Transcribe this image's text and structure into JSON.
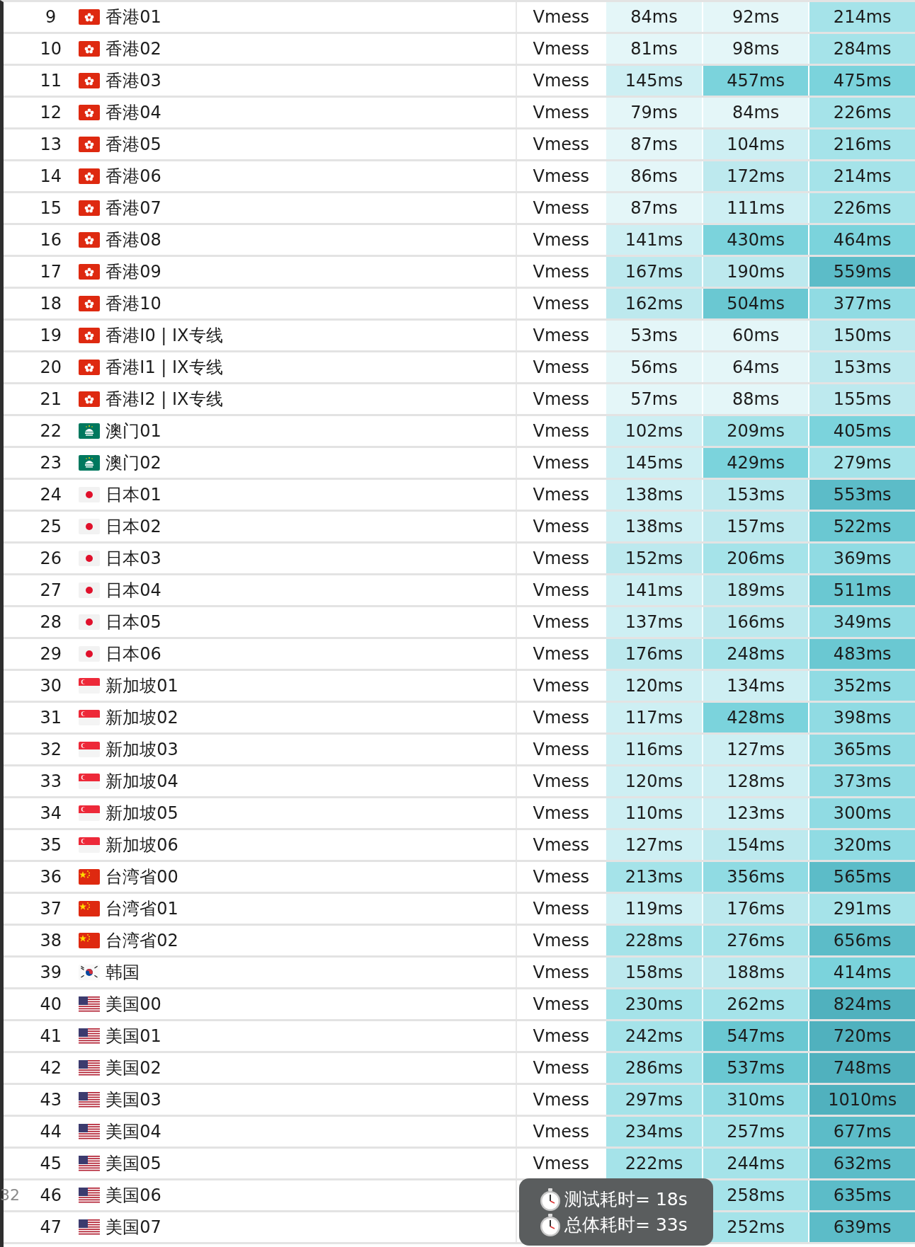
{
  "rows": [
    {
      "index": "9",
      "kind": "hk",
      "name": "香港01",
      "protocol": "Vmess",
      "latencies": [
        {
          "text": "84ms",
          "color": "#e4f6f8"
        },
        {
          "text": "92ms",
          "color": "#e4f6f8"
        },
        {
          "text": "214ms",
          "color": "#a5e3e9"
        }
      ]
    },
    {
      "index": "10",
      "kind": "hk",
      "name": "香港02",
      "protocol": "Vmess",
      "latencies": [
        {
          "text": "81ms",
          "color": "#e4f6f8"
        },
        {
          "text": "98ms",
          "color": "#e4f6f8"
        },
        {
          "text": "284ms",
          "color": "#a5e3e9"
        }
      ]
    },
    {
      "index": "11",
      "kind": "hk",
      "name": "香港03",
      "protocol": "Vmess",
      "latencies": [
        {
          "text": "145ms",
          "color": "#ceeff3"
        },
        {
          "text": "457ms",
          "color": "#7bd3dc"
        },
        {
          "text": "475ms",
          "color": "#7bd3dc"
        }
      ]
    },
    {
      "index": "12",
      "kind": "hk",
      "name": "香港04",
      "protocol": "Vmess",
      "latencies": [
        {
          "text": "79ms",
          "color": "#e4f6f8"
        },
        {
          "text": "84ms",
          "color": "#e4f6f8"
        },
        {
          "text": "226ms",
          "color": "#a5e3e9"
        }
      ]
    },
    {
      "index": "13",
      "kind": "hk",
      "name": "香港05",
      "protocol": "Vmess",
      "latencies": [
        {
          "text": "87ms",
          "color": "#e4f6f8"
        },
        {
          "text": "104ms",
          "color": "#ceeff3"
        },
        {
          "text": "216ms",
          "color": "#a5e3e9"
        }
      ]
    },
    {
      "index": "14",
      "kind": "hk",
      "name": "香港06",
      "protocol": "Vmess",
      "latencies": [
        {
          "text": "86ms",
          "color": "#e4f6f8"
        },
        {
          "text": "172ms",
          "color": "#bde9ee"
        },
        {
          "text": "214ms",
          "color": "#a5e3e9"
        }
      ]
    },
    {
      "index": "15",
      "kind": "hk",
      "name": "香港07",
      "protocol": "Vmess",
      "latencies": [
        {
          "text": "87ms",
          "color": "#e4f6f8"
        },
        {
          "text": "111ms",
          "color": "#ceeff3"
        },
        {
          "text": "226ms",
          "color": "#a5e3e9"
        }
      ]
    },
    {
      "index": "16",
      "kind": "hk",
      "name": "香港08",
      "protocol": "Vmess",
      "latencies": [
        {
          "text": "141ms",
          "color": "#ceeff3"
        },
        {
          "text": "430ms",
          "color": "#7bd3dc"
        },
        {
          "text": "464ms",
          "color": "#7bd3dc"
        }
      ]
    },
    {
      "index": "17",
      "kind": "hk",
      "name": "香港09",
      "protocol": "Vmess",
      "latencies": [
        {
          "text": "167ms",
          "color": "#bde9ee"
        },
        {
          "text": "190ms",
          "color": "#bde9ee"
        },
        {
          "text": "559ms",
          "color": "#5cbcc8"
        }
      ]
    },
    {
      "index": "18",
      "kind": "hk",
      "name": "香港10",
      "protocol": "Vmess",
      "latencies": [
        {
          "text": "162ms",
          "color": "#bde9ee"
        },
        {
          "text": "504ms",
          "color": "#6ac8d2"
        },
        {
          "text": "377ms",
          "color": "#90dbe3"
        }
      ]
    },
    {
      "index": "19",
      "kind": "hk",
      "name": "香港I0 | IX专线",
      "protocol": "Vmess",
      "latencies": [
        {
          "text": "53ms",
          "color": "#e4f6f8"
        },
        {
          "text": "60ms",
          "color": "#e4f6f8"
        },
        {
          "text": "150ms",
          "color": "#bde9ee"
        }
      ]
    },
    {
      "index": "20",
      "kind": "hk",
      "name": "香港I1 | IX专线",
      "protocol": "Vmess",
      "latencies": [
        {
          "text": "56ms",
          "color": "#e4f6f8"
        },
        {
          "text": "64ms",
          "color": "#e4f6f8"
        },
        {
          "text": "153ms",
          "color": "#bde9ee"
        }
      ]
    },
    {
      "index": "21",
      "kind": "hk",
      "name": "香港I2 | IX专线",
      "protocol": "Vmess",
      "latencies": [
        {
          "text": "57ms",
          "color": "#e4f6f8"
        },
        {
          "text": "88ms",
          "color": "#e4f6f8"
        },
        {
          "text": "155ms",
          "color": "#bde9ee"
        }
      ]
    },
    {
      "index": "22",
      "kind": "mo",
      "name": "澳门01",
      "protocol": "Vmess",
      "latencies": [
        {
          "text": "102ms",
          "color": "#ceeff3"
        },
        {
          "text": "209ms",
          "color": "#a5e3e9"
        },
        {
          "text": "405ms",
          "color": "#7bd3dc"
        }
      ]
    },
    {
      "index": "23",
      "kind": "mo",
      "name": "澳门02",
      "protocol": "Vmess",
      "latencies": [
        {
          "text": "145ms",
          "color": "#ceeff3"
        },
        {
          "text": "429ms",
          "color": "#7bd3dc"
        },
        {
          "text": "279ms",
          "color": "#a5e3e9"
        }
      ]
    },
    {
      "index": "24",
      "kind": "jp",
      "name": "日本01",
      "protocol": "Vmess",
      "latencies": [
        {
          "text": "138ms",
          "color": "#ceeff3"
        },
        {
          "text": "153ms",
          "color": "#bde9ee"
        },
        {
          "text": "553ms",
          "color": "#5cbcc8"
        }
      ]
    },
    {
      "index": "25",
      "kind": "jp",
      "name": "日本02",
      "protocol": "Vmess",
      "latencies": [
        {
          "text": "138ms",
          "color": "#ceeff3"
        },
        {
          "text": "157ms",
          "color": "#bde9ee"
        },
        {
          "text": "522ms",
          "color": "#6ac8d2"
        }
      ]
    },
    {
      "index": "26",
      "kind": "jp",
      "name": "日本03",
      "protocol": "Vmess",
      "latencies": [
        {
          "text": "152ms",
          "color": "#bde9ee"
        },
        {
          "text": "206ms",
          "color": "#a5e3e9"
        },
        {
          "text": "369ms",
          "color": "#90dbe3"
        }
      ]
    },
    {
      "index": "27",
      "kind": "jp",
      "name": "日本04",
      "protocol": "Vmess",
      "latencies": [
        {
          "text": "141ms",
          "color": "#ceeff3"
        },
        {
          "text": "189ms",
          "color": "#bde9ee"
        },
        {
          "text": "511ms",
          "color": "#6ac8d2"
        }
      ]
    },
    {
      "index": "28",
      "kind": "jp",
      "name": "日本05",
      "protocol": "Vmess",
      "latencies": [
        {
          "text": "137ms",
          "color": "#ceeff3"
        },
        {
          "text": "166ms",
          "color": "#bde9ee"
        },
        {
          "text": "349ms",
          "color": "#90dbe3"
        }
      ]
    },
    {
      "index": "29",
      "kind": "jp",
      "name": "日本06",
      "protocol": "Vmess",
      "latencies": [
        {
          "text": "176ms",
          "color": "#bde9ee"
        },
        {
          "text": "248ms",
          "color": "#a5e3e9"
        },
        {
          "text": "483ms",
          "color": "#6ac8d2"
        }
      ]
    },
    {
      "index": "30",
      "kind": "sg",
      "name": "新加坡01",
      "protocol": "Vmess",
      "latencies": [
        {
          "text": "120ms",
          "color": "#ceeff3"
        },
        {
          "text": "134ms",
          "color": "#ceeff3"
        },
        {
          "text": "352ms",
          "color": "#90dbe3"
        }
      ]
    },
    {
      "index": "31",
      "kind": "sg",
      "name": "新加坡02",
      "protocol": "Vmess",
      "latencies": [
        {
          "text": "117ms",
          "color": "#ceeff3"
        },
        {
          "text": "428ms",
          "color": "#7bd3dc"
        },
        {
          "text": "398ms",
          "color": "#90dbe3"
        }
      ]
    },
    {
      "index": "32",
      "kind": "sg",
      "name": "新加坡03",
      "protocol": "Vmess",
      "latencies": [
        {
          "text": "116ms",
          "color": "#ceeff3"
        },
        {
          "text": "127ms",
          "color": "#ceeff3"
        },
        {
          "text": "365ms",
          "color": "#90dbe3"
        }
      ]
    },
    {
      "index": "33",
      "kind": "sg",
      "name": "新加坡04",
      "protocol": "Vmess",
      "latencies": [
        {
          "text": "120ms",
          "color": "#ceeff3"
        },
        {
          "text": "128ms",
          "color": "#ceeff3"
        },
        {
          "text": "373ms",
          "color": "#90dbe3"
        }
      ]
    },
    {
      "index": "34",
      "kind": "sg",
      "name": "新加坡05",
      "protocol": "Vmess",
      "latencies": [
        {
          "text": "110ms",
          "color": "#ceeff3"
        },
        {
          "text": "123ms",
          "color": "#ceeff3"
        },
        {
          "text": "300ms",
          "color": "#90dbe3"
        }
      ]
    },
    {
      "index": "35",
      "kind": "sg",
      "name": "新加坡06",
      "protocol": "Vmess",
      "latencies": [
        {
          "text": "127ms",
          "color": "#ceeff3"
        },
        {
          "text": "154ms",
          "color": "#bde9ee"
        },
        {
          "text": "320ms",
          "color": "#90dbe3"
        }
      ]
    },
    {
      "index": "36",
      "kind": "cn",
      "name": "台湾省00",
      "protocol": "Vmess",
      "latencies": [
        {
          "text": "213ms",
          "color": "#a5e3e9"
        },
        {
          "text": "356ms",
          "color": "#90dbe3"
        },
        {
          "text": "565ms",
          "color": "#5cbcc8"
        }
      ]
    },
    {
      "index": "37",
      "kind": "cn",
      "name": "台湾省01",
      "protocol": "Vmess",
      "latencies": [
        {
          "text": "119ms",
          "color": "#ceeff3"
        },
        {
          "text": "176ms",
          "color": "#bde9ee"
        },
        {
          "text": "291ms",
          "color": "#a5e3e9"
        }
      ]
    },
    {
      "index": "38",
      "kind": "cn",
      "name": "台湾省02",
      "protocol": "Vmess",
      "latencies": [
        {
          "text": "228ms",
          "color": "#a5e3e9"
        },
        {
          "text": "276ms",
          "color": "#a5e3e9"
        },
        {
          "text": "656ms",
          "color": "#5cbcc8"
        }
      ]
    },
    {
      "index": "39",
      "kind": "kr",
      "name": "韩国",
      "protocol": "Vmess",
      "latencies": [
        {
          "text": "158ms",
          "color": "#bde9ee"
        },
        {
          "text": "188ms",
          "color": "#bde9ee"
        },
        {
          "text": "414ms",
          "color": "#7bd3dc"
        }
      ]
    },
    {
      "index": "40",
      "kind": "us",
      "name": "美国00",
      "protocol": "Vmess",
      "latencies": [
        {
          "text": "230ms",
          "color": "#a5e3e9"
        },
        {
          "text": "262ms",
          "color": "#a5e3e9"
        },
        {
          "text": "824ms",
          "color": "#50b1be"
        }
      ]
    },
    {
      "index": "41",
      "kind": "us",
      "name": "美国01",
      "protocol": "Vmess",
      "latencies": [
        {
          "text": "242ms",
          "color": "#a5e3e9"
        },
        {
          "text": "547ms",
          "color": "#6ac8d2"
        },
        {
          "text": "720ms",
          "color": "#50b1be"
        }
      ]
    },
    {
      "index": "42",
      "kind": "us",
      "name": "美国02",
      "protocol": "Vmess",
      "latencies": [
        {
          "text": "286ms",
          "color": "#a5e3e9"
        },
        {
          "text": "537ms",
          "color": "#6ac8d2"
        },
        {
          "text": "748ms",
          "color": "#50b1be"
        }
      ]
    },
    {
      "index": "43",
      "kind": "us",
      "name": "美国03",
      "protocol": "Vmess",
      "latencies": [
        {
          "text": "297ms",
          "color": "#a5e3e9"
        },
        {
          "text": "310ms",
          "color": "#90dbe3"
        },
        {
          "text": "1010ms",
          "color": "#50b1be"
        }
      ]
    },
    {
      "index": "44",
      "kind": "us",
      "name": "美国04",
      "protocol": "Vmess",
      "latencies": [
        {
          "text": "234ms",
          "color": "#a5e3e9"
        },
        {
          "text": "257ms",
          "color": "#a5e3e9"
        },
        {
          "text": "677ms",
          "color": "#5cbcc8"
        }
      ]
    },
    {
      "index": "45",
      "kind": "us",
      "name": "美国05",
      "protocol": "Vmess",
      "latencies": [
        {
          "text": "222ms",
          "color": "#a5e3e9"
        },
        {
          "text": "244ms",
          "color": "#a5e3e9"
        },
        {
          "text": "632ms",
          "color": "#5cbcc8"
        }
      ]
    },
    {
      "index": "46",
      "kind": "us",
      "name": "美国06",
      "latencies": [
        {
          "text": "258ms",
          "color": "#a5e3e9"
        },
        {
          "text": "635ms",
          "color": "#5cbcc8"
        }
      ]
    },
    {
      "index": "47",
      "kind": "us",
      "name": "美国07",
      "latencies": [
        {
          "text": "252ms",
          "color": "#a5e3e9"
        },
        {
          "text": "639ms",
          "color": "#5cbcc8"
        }
      ]
    }
  ],
  "edge_label": "32",
  "toast": {
    "lines": [
      "测试耗时= 18s",
      "总体耗时= 33s"
    ]
  }
}
